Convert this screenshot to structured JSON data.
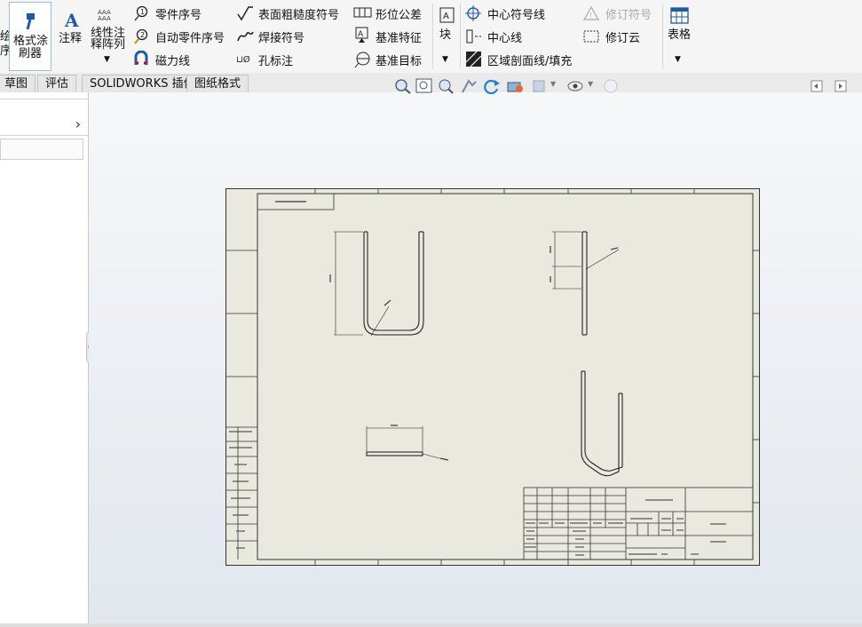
{
  "ribbon": {
    "left_cut_a": "绘",
    "left_cut_b": "序",
    "format_painter": "格式涂",
    "format_painter2": "刷器",
    "annotation": "注释",
    "linear_note": "线性注",
    "linear_note2": "释阵列",
    "balloon": "零件序号",
    "auto_balloon": "自动零件序号",
    "magnetic_line": "磁力线",
    "surface_finish": "表面粗糙度符号",
    "weld_symbol": "焊接符号",
    "hole_callout": "孔标注",
    "geometric_tolerance": "形位公差",
    "datum_feature": "基准特征",
    "datum_target": "基准目标",
    "block": "块",
    "center_mark": "中心符号线",
    "centerline": "中心线",
    "area_hatch": "区域剖面线/填充",
    "revision_symbol": "修订符号",
    "revision_cloud": "修订云",
    "table": "表格"
  },
  "tabs": [
    {
      "label": "草图"
    },
    {
      "label": "评估"
    },
    {
      "label": "SOLIDWORKS 插件"
    },
    {
      "label": "图纸格式"
    }
  ],
  "colors": {
    "sheet_bg": "#e9e9e0",
    "icon_blue": "#1f5aa6",
    "line_dark": "#222222"
  }
}
